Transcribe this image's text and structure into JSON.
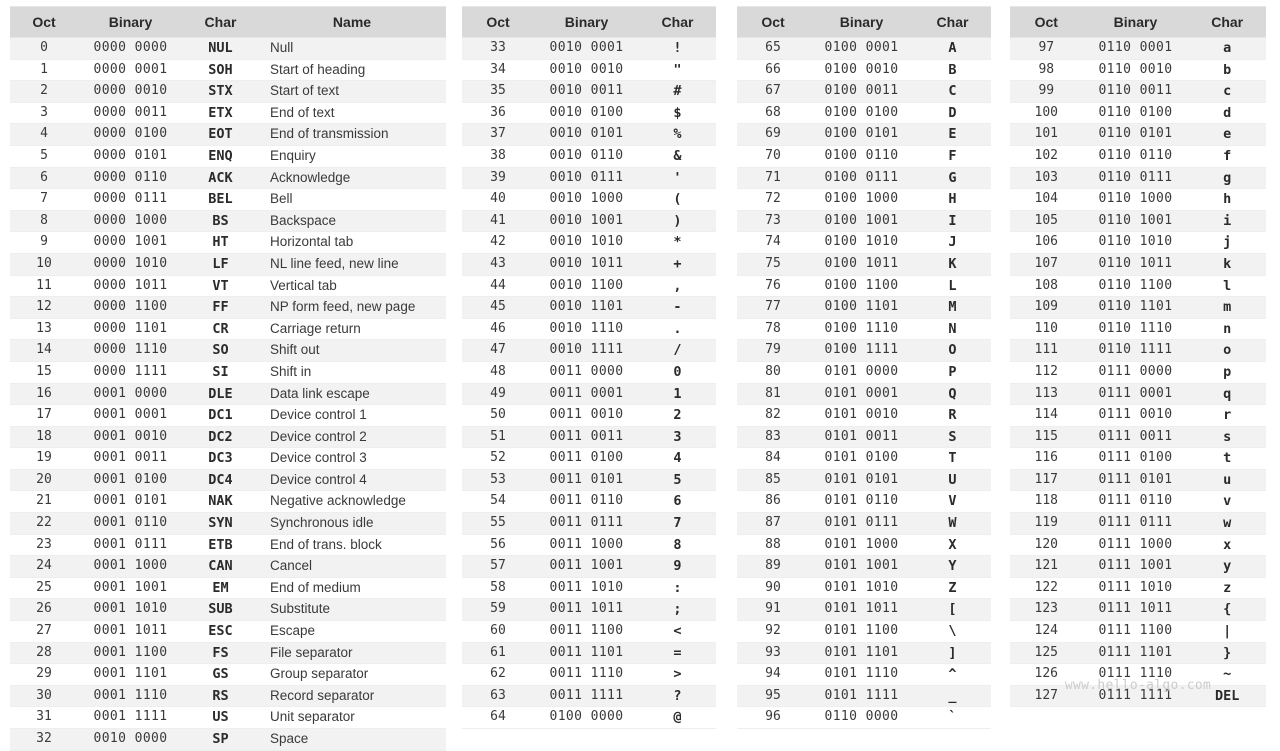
{
  "watermark": "www.hello-algo.com",
  "colors": {
    "header_bg": "#d9d9d9",
    "row_alt_bg": "#f2f2f2",
    "row_bg": "#ffffff",
    "text": "#3a3a3a",
    "border": "#eeeeee",
    "watermark_text": "#cccccc"
  },
  "tables": [
    {
      "id": "table-1",
      "columns": [
        "Oct",
        "Binary",
        "Char",
        "Name"
      ],
      "rows": [
        [
          "0",
          "0000 0000",
          "NUL",
          "Null"
        ],
        [
          "1",
          "0000 0001",
          "SOH",
          "Start of heading"
        ],
        [
          "2",
          "0000 0010",
          "STX",
          "Start of text"
        ],
        [
          "3",
          "0000 0011",
          "ETX",
          "End of text"
        ],
        [
          "4",
          "0000 0100",
          "EOT",
          "End of transmission"
        ],
        [
          "5",
          "0000 0101",
          "ENQ",
          "Enquiry"
        ],
        [
          "6",
          "0000 0110",
          "ACK",
          "Acknowledge"
        ],
        [
          "7",
          "0000 0111",
          "BEL",
          "Bell"
        ],
        [
          "8",
          "0000 1000",
          "BS",
          "Backspace"
        ],
        [
          "9",
          "0000 1001",
          "HT",
          "Horizontal tab"
        ],
        [
          "10",
          "0000 1010",
          "LF",
          "NL line feed, new line"
        ],
        [
          "11",
          "0000 1011",
          "VT",
          "Vertical tab"
        ],
        [
          "12",
          "0000 1100",
          "FF",
          "NP form feed, new page"
        ],
        [
          "13",
          "0000 1101",
          "CR",
          "Carriage return"
        ],
        [
          "14",
          "0000 1110",
          "SO",
          "Shift out"
        ],
        [
          "15",
          "0000 1111",
          "SI",
          "Shift in"
        ],
        [
          "16",
          "0001 0000",
          "DLE",
          "Data link escape"
        ],
        [
          "17",
          "0001 0001",
          "DC1",
          "Device control 1"
        ],
        [
          "18",
          "0001 0010",
          "DC2",
          "Device control 2"
        ],
        [
          "19",
          "0001 0011",
          "DC3",
          "Device control 3"
        ],
        [
          "20",
          "0001 0100",
          "DC4",
          "Device control 4"
        ],
        [
          "21",
          "0001 0101",
          "NAK",
          "Negative acknowledge"
        ],
        [
          "22",
          "0001 0110",
          "SYN",
          "Synchronous idle"
        ],
        [
          "23",
          "0001 0111",
          "ETB",
          "End of trans. block"
        ],
        [
          "24",
          "0001 1000",
          "CAN",
          "Cancel"
        ],
        [
          "25",
          "0001 1001",
          "EM",
          "End of medium"
        ],
        [
          "26",
          "0001 1010",
          "SUB",
          "Substitute"
        ],
        [
          "27",
          "0001 1011",
          "ESC",
          "Escape"
        ],
        [
          "28",
          "0001 1100",
          "FS",
          "File separator"
        ],
        [
          "29",
          "0001 1101",
          "GS",
          "Group separator"
        ],
        [
          "30",
          "0001 1110",
          "RS",
          "Record separator"
        ],
        [
          "31",
          "0001 1111",
          "US",
          "Unit separator"
        ],
        [
          "32",
          "0010 0000",
          "SP",
          "Space"
        ]
      ]
    },
    {
      "id": "table-2",
      "columns": [
        "Oct",
        "Binary",
        "Char"
      ],
      "rows": [
        [
          "33",
          "0010 0001",
          "!"
        ],
        [
          "34",
          "0010 0010",
          "\""
        ],
        [
          "35",
          "0010 0011",
          "#"
        ],
        [
          "36",
          "0010 0100",
          "$"
        ],
        [
          "37",
          "0010 0101",
          "%"
        ],
        [
          "38",
          "0010 0110",
          "&"
        ],
        [
          "39",
          "0010 0111",
          "'"
        ],
        [
          "40",
          "0010 1000",
          "("
        ],
        [
          "41",
          "0010 1001",
          ")"
        ],
        [
          "42",
          "0010 1010",
          "*"
        ],
        [
          "43",
          "0010 1011",
          "+"
        ],
        [
          "44",
          "0010 1100",
          ","
        ],
        [
          "45",
          "0010 1101",
          "-"
        ],
        [
          "46",
          "0010 1110",
          "."
        ],
        [
          "47",
          "0010 1111",
          "/"
        ],
        [
          "48",
          "0011 0000",
          "0"
        ],
        [
          "49",
          "0011 0001",
          "1"
        ],
        [
          "50",
          "0011 0010",
          "2"
        ],
        [
          "51",
          "0011 0011",
          "3"
        ],
        [
          "52",
          "0011 0100",
          "4"
        ],
        [
          "53",
          "0011 0101",
          "5"
        ],
        [
          "54",
          "0011 0110",
          "6"
        ],
        [
          "55",
          "0011 0111",
          "7"
        ],
        [
          "56",
          "0011 1000",
          "8"
        ],
        [
          "57",
          "0011 1001",
          "9"
        ],
        [
          "58",
          "0011 1010",
          ":"
        ],
        [
          "59",
          "0011 1011",
          ";"
        ],
        [
          "60",
          "0011 1100",
          "<"
        ],
        [
          "61",
          "0011 1101",
          "="
        ],
        [
          "62",
          "0011 1110",
          ">"
        ],
        [
          "63",
          "0011 1111",
          "?"
        ],
        [
          "64",
          "0100 0000",
          "@"
        ]
      ]
    },
    {
      "id": "table-3",
      "columns": [
        "Oct",
        "Binary",
        "Char"
      ],
      "rows": [
        [
          "65",
          "0100 0001",
          "A"
        ],
        [
          "66",
          "0100 0010",
          "B"
        ],
        [
          "67",
          "0100 0011",
          "C"
        ],
        [
          "68",
          "0100 0100",
          "D"
        ],
        [
          "69",
          "0100 0101",
          "E"
        ],
        [
          "70",
          "0100 0110",
          "F"
        ],
        [
          "71",
          "0100 0111",
          "G"
        ],
        [
          "72",
          "0100 1000",
          "H"
        ],
        [
          "73",
          "0100 1001",
          "I"
        ],
        [
          "74",
          "0100 1010",
          "J"
        ],
        [
          "75",
          "0100 1011",
          "K"
        ],
        [
          "76",
          "0100 1100",
          "L"
        ],
        [
          "77",
          "0100 1101",
          "M"
        ],
        [
          "78",
          "0100 1110",
          "N"
        ],
        [
          "79",
          "0100 1111",
          "O"
        ],
        [
          "80",
          "0101 0000",
          "P"
        ],
        [
          "81",
          "0101 0001",
          "Q"
        ],
        [
          "82",
          "0101 0010",
          "R"
        ],
        [
          "83",
          "0101 0011",
          "S"
        ],
        [
          "84",
          "0101 0100",
          "T"
        ],
        [
          "85",
          "0101 0101",
          "U"
        ],
        [
          "86",
          "0101 0110",
          "V"
        ],
        [
          "87",
          "0101 0111",
          "W"
        ],
        [
          "88",
          "0101 1000",
          "X"
        ],
        [
          "89",
          "0101 1001",
          "Y"
        ],
        [
          "90",
          "0101 1010",
          "Z"
        ],
        [
          "91",
          "0101 1011",
          "["
        ],
        [
          "92",
          "0101 1100",
          "\\"
        ],
        [
          "93",
          "0101 1101",
          "]"
        ],
        [
          "94",
          "0101 1110",
          "^"
        ],
        [
          "95",
          "0101 1111",
          "_"
        ],
        [
          "96",
          "0110 0000",
          "`"
        ]
      ]
    },
    {
      "id": "table-4",
      "columns": [
        "Oct",
        "Binary",
        "Char"
      ],
      "rows": [
        [
          "97",
          "0110 0001",
          "a"
        ],
        [
          "98",
          "0110 0010",
          "b"
        ],
        [
          "99",
          "0110 0011",
          "c"
        ],
        [
          "100",
          "0110 0100",
          "d"
        ],
        [
          "101",
          "0110 0101",
          "e"
        ],
        [
          "102",
          "0110 0110",
          "f"
        ],
        [
          "103",
          "0110 0111",
          "g"
        ],
        [
          "104",
          "0110 1000",
          "h"
        ],
        [
          "105",
          "0110 1001",
          "i"
        ],
        [
          "106",
          "0110 1010",
          "j"
        ],
        [
          "107",
          "0110 1011",
          "k"
        ],
        [
          "108",
          "0110 1100",
          "l"
        ],
        [
          "109",
          "0110 1101",
          "m"
        ],
        [
          "110",
          "0110 1110",
          "n"
        ],
        [
          "111",
          "0110 1111",
          "o"
        ],
        [
          "112",
          "0111 0000",
          "p"
        ],
        [
          "113",
          "0111 0001",
          "q"
        ],
        [
          "114",
          "0111 0010",
          "r"
        ],
        [
          "115",
          "0111 0011",
          "s"
        ],
        [
          "116",
          "0111 0100",
          "t"
        ],
        [
          "117",
          "0111 0101",
          "u"
        ],
        [
          "118",
          "0111 0110",
          "v"
        ],
        [
          "119",
          "0111 0111",
          "w"
        ],
        [
          "120",
          "0111 1000",
          "x"
        ],
        [
          "121",
          "0111 1001",
          "y"
        ],
        [
          "122",
          "0111 1010",
          "z"
        ],
        [
          "123",
          "0111 1011",
          "{"
        ],
        [
          "124",
          "0111 1100",
          "|"
        ],
        [
          "125",
          "0111 1101",
          "}"
        ],
        [
          "126",
          "0111 1110",
          "~"
        ],
        [
          "127",
          "0111 1111",
          "DEL"
        ]
      ]
    }
  ]
}
